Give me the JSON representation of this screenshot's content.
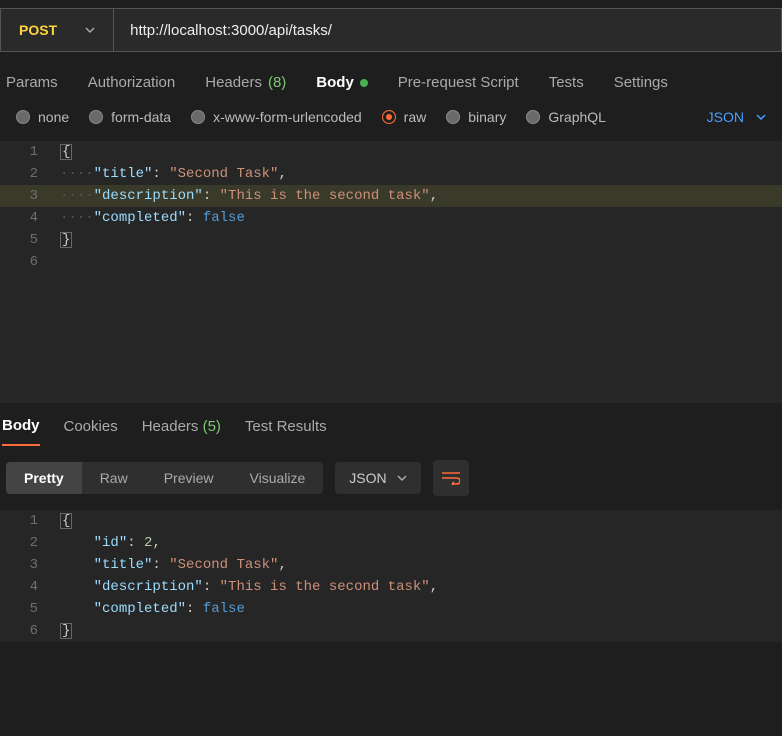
{
  "request": {
    "method": "POST",
    "url": "http://localhost:3000/api/tasks/"
  },
  "reqTabs": {
    "params": "Params",
    "authorization": "Authorization",
    "headers": "Headers",
    "headers_count": "(8)",
    "body": "Body",
    "prerequest": "Pre-request Script",
    "tests": "Tests",
    "settings": "Settings"
  },
  "bodyTypes": {
    "none": "none",
    "formdata": "form-data",
    "urlencoded": "x-www-form-urlencoded",
    "raw": "raw",
    "binary": "binary",
    "graphql": "GraphQL",
    "json": "JSON"
  },
  "reqBody": {
    "l1": "{",
    "l2_key": "\"title\"",
    "l2_val": "\"Second Task\"",
    "l3_key": "\"description\"",
    "l3_val": "\"This is the second task\"",
    "l4_key": "\"completed\"",
    "l4_val": "false",
    "l5": "}"
  },
  "respTabs": {
    "body": "Body",
    "cookies": "Cookies",
    "headers": "Headers",
    "headers_count": "(5)",
    "testresults": "Test Results"
  },
  "viewModes": {
    "pretty": "Pretty",
    "raw": "Raw",
    "preview": "Preview",
    "visualize": "Visualize",
    "json": "JSON"
  },
  "respBody": {
    "l1": "{",
    "l2_key": "\"id\"",
    "l2_val": "2",
    "l3_key": "\"title\"",
    "l3_val": "\"Second Task\"",
    "l4_key": "\"description\"",
    "l4_val": "\"This is the second task\"",
    "l5_key": "\"completed\"",
    "l5_val": "false",
    "l6": "}"
  },
  "lineNums": {
    "1": "1",
    "2": "2",
    "3": "3",
    "4": "4",
    "5": "5",
    "6": "6"
  }
}
